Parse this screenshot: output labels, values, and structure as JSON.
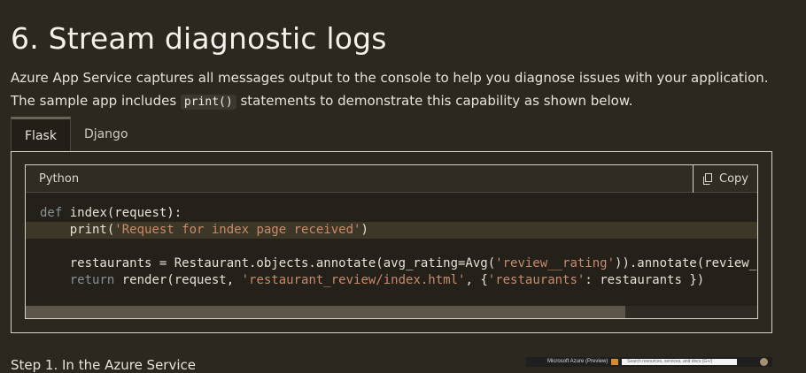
{
  "heading": "6. Stream diagnostic logs",
  "intro": {
    "before": "Azure App Service captures all messages output to the console to help you diagnose issues with your application. The sample app includes ",
    "code": "print()",
    "after": " statements to demonstrate this capability as shown below."
  },
  "tabs": [
    {
      "label": "Flask",
      "active": true
    },
    {
      "label": "Django",
      "active": false
    }
  ],
  "code_block": {
    "language": "Python",
    "copy_label": "Copy",
    "lines": [
      {
        "kw": "def",
        "rest": " index(request):"
      },
      {
        "pre": "    print(",
        "str": "'Request for index page received'",
        "post": ")"
      },
      {
        "text": ""
      },
      {
        "pre": "    restaurants = Restaurant.objects.annotate(avg_rating=Avg(",
        "str": "'review__rating'",
        "post": ")).annotate(review_c"
      },
      {
        "kw": "    return",
        "pre": " render(request, ",
        "str": "'restaurant_review/index.html'",
        "post": ", {",
        "str2": "'restaurants'",
        "post2": ": restaurants })"
      }
    ],
    "scroll_fraction": 0.82
  },
  "step_text": "Step 1. In the Azure Service",
  "thumbnail": {
    "title": "Microsoft Azure (Preview)",
    "search_placeholder": "Search resources, services, and docs (G+/)"
  },
  "colors": {
    "background": "#2b2820",
    "code_background": "#24211b",
    "highlight": "#3d3727",
    "string": "#c98a6a",
    "keyword": "#8a8f96"
  }
}
